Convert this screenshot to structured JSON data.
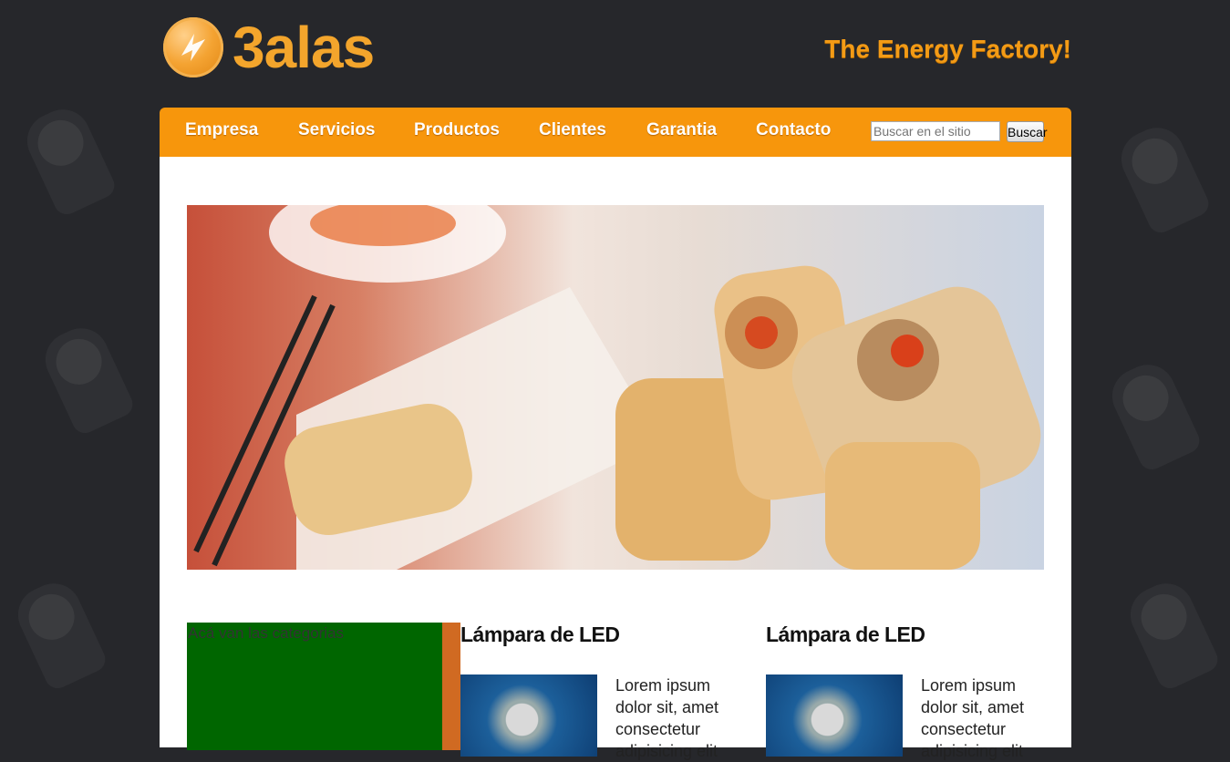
{
  "brand": {
    "name": "3alas",
    "tagline": "The Energy Factory!"
  },
  "nav": {
    "items": [
      "Empresa",
      "Servicios",
      "Productos",
      "Clientes",
      "Garantia",
      "Contacto"
    ],
    "search": {
      "placeholder": "Buscar en el sitio",
      "button": "Buscar"
    }
  },
  "sidebar": {
    "categories_label": "Acá van las categorias"
  },
  "products": [
    {
      "title": "Lámpara de LED",
      "text": "Lorem ipsum dolor sit, amet consectetur adipisicing elit"
    },
    {
      "title": "Lámpara de LED",
      "text": "Lorem ipsum dolor sit, amet consectetur adipisicing elit"
    }
  ],
  "colors": {
    "accent": "#f7960c",
    "background": "#26272b",
    "categories_bg": "#006600",
    "categories_border": "#d06a22"
  }
}
